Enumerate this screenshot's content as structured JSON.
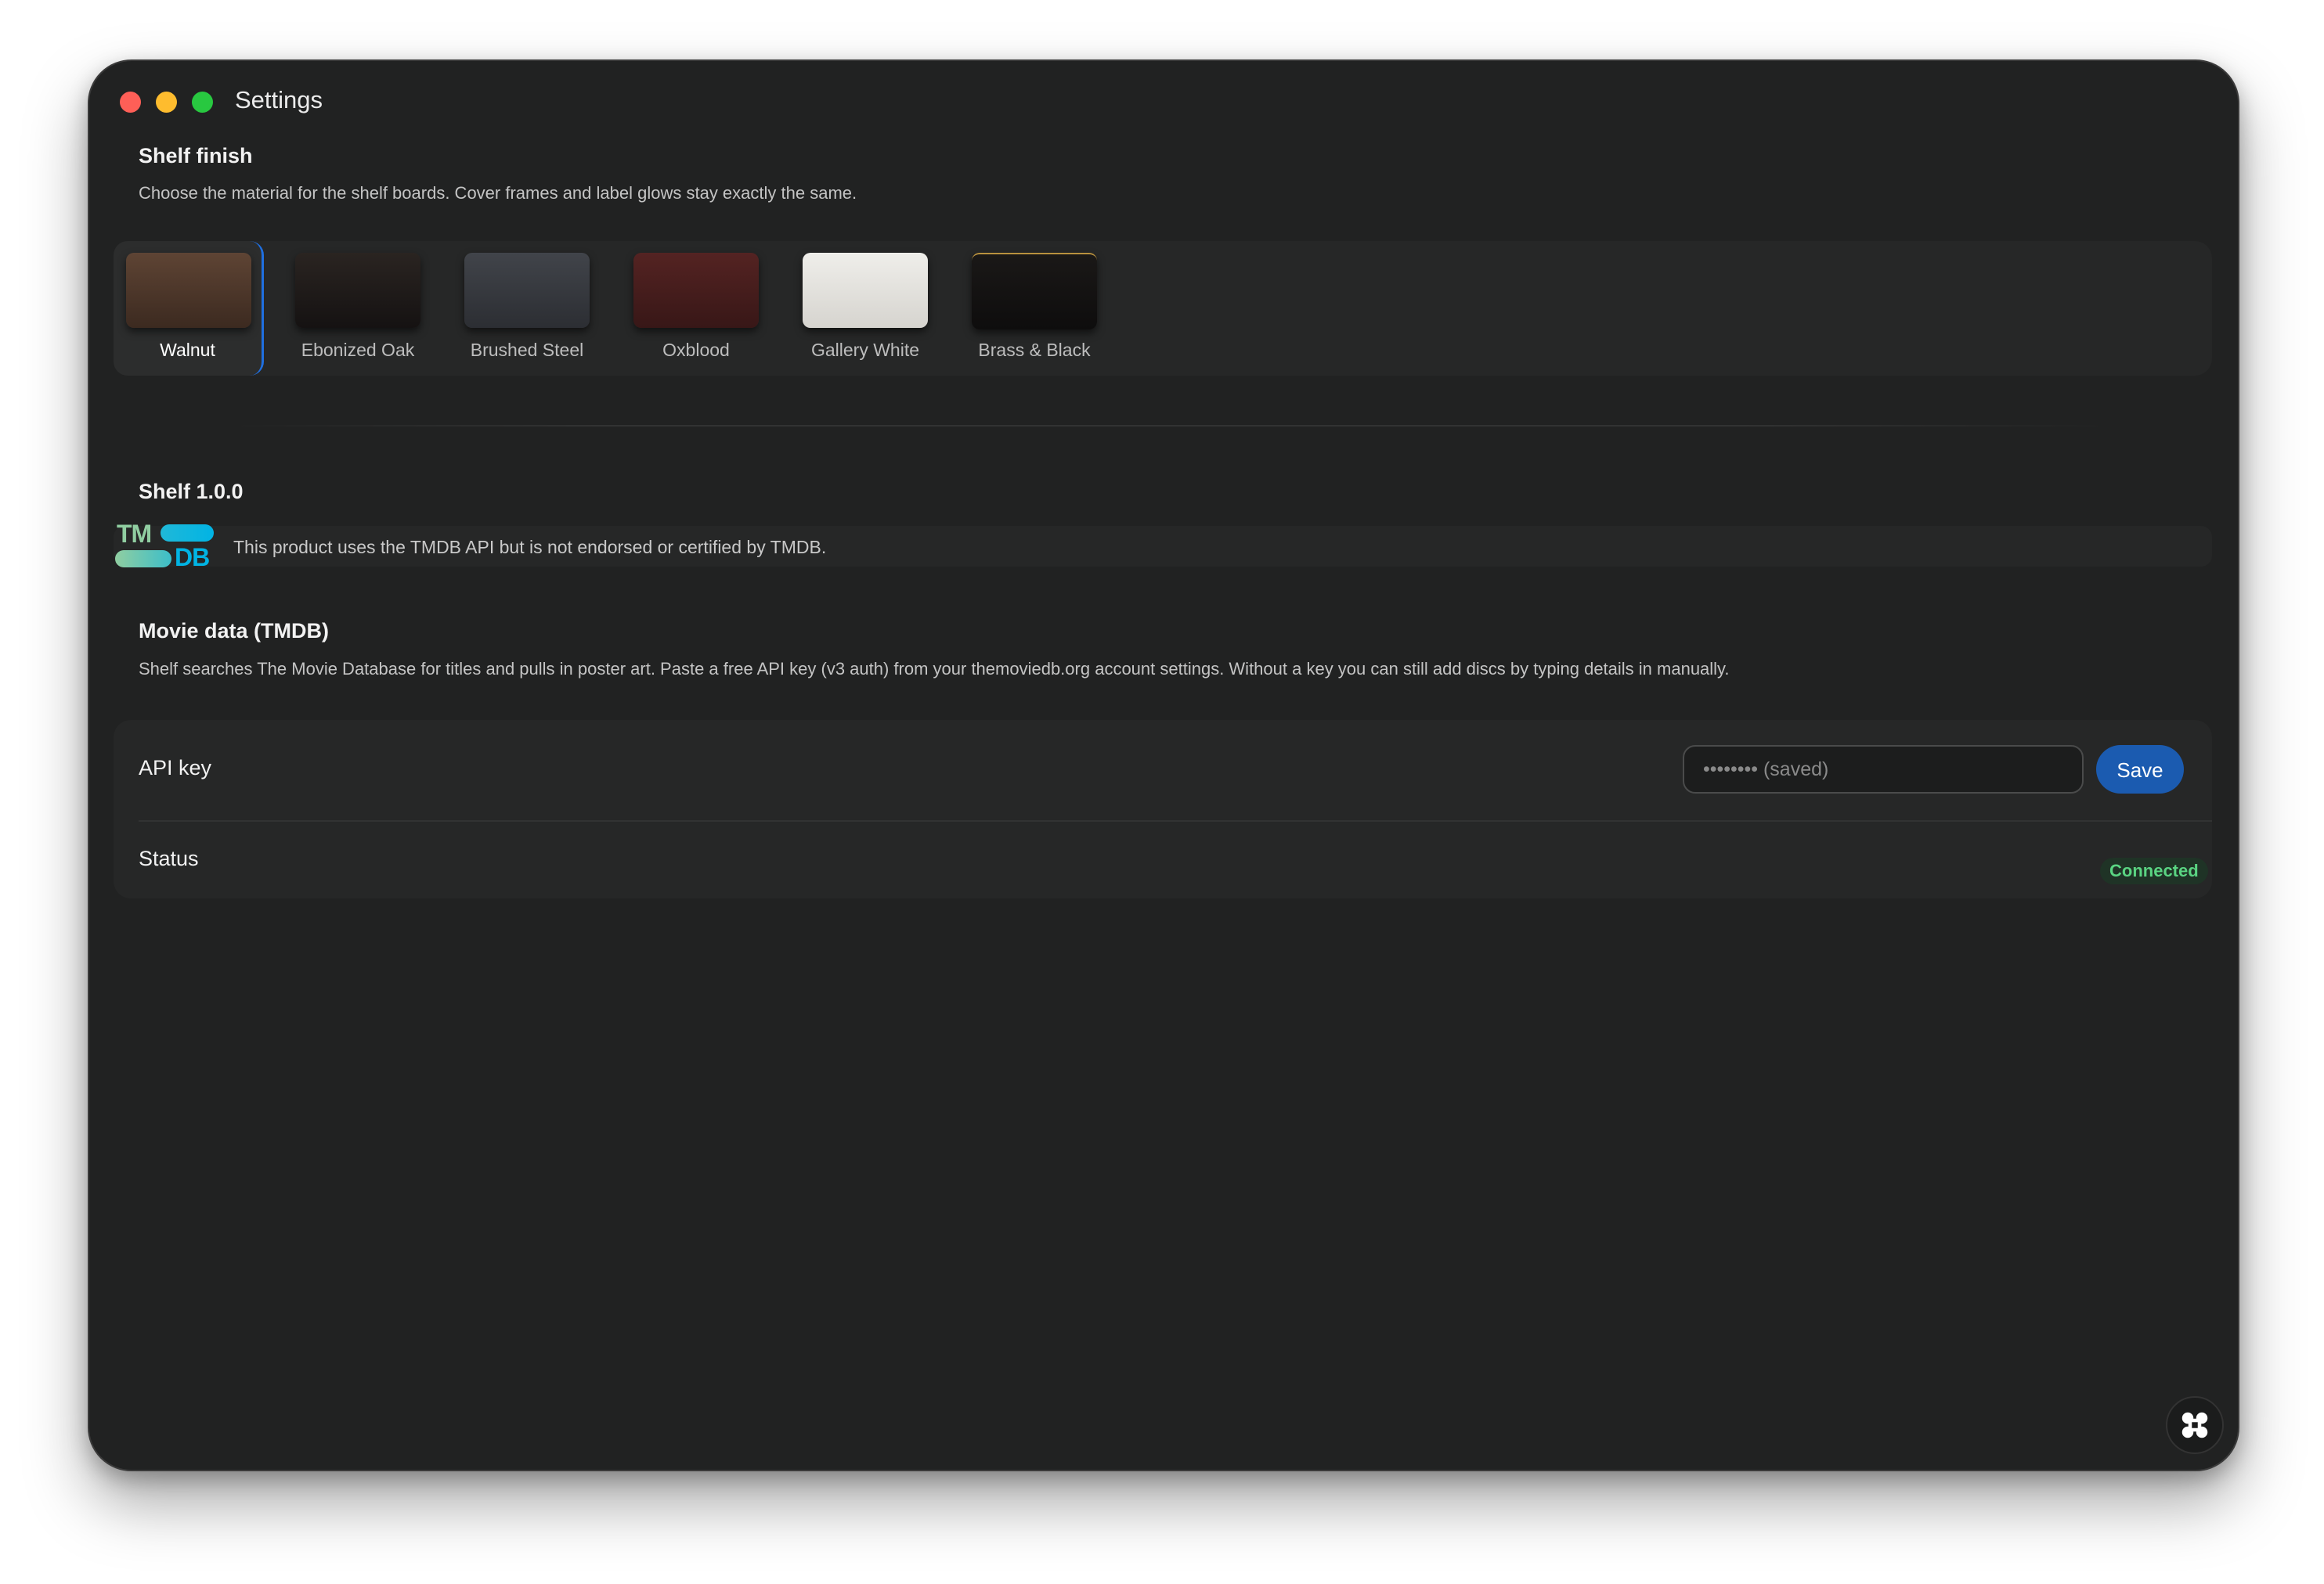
{
  "window": {
    "title": "Settings"
  },
  "shelf_finish": {
    "title": "Shelf finish",
    "description": "Choose the material for the shelf boards. Cover frames and label glows stay exactly the same.",
    "selected": "Walnut",
    "options": [
      {
        "label": "Walnut",
        "color": "#5a4030"
      },
      {
        "label": "Ebonized Oak",
        "color": "#221c1a"
      },
      {
        "label": "Brushed Steel",
        "color": "#3a3d43"
      },
      {
        "label": "Oxblood",
        "color": "#4a1f1f"
      },
      {
        "label": "Gallery White",
        "color": "#e4e3df"
      },
      {
        "label": "Brass & Black",
        "color": "#151414"
      }
    ]
  },
  "about": {
    "title": "Shelf 1.0.0",
    "logo_top": "TM",
    "logo_bottom": "DB",
    "attribution": "This product uses the TMDB API but is not endorsed or certified by TMDB."
  },
  "movie_data": {
    "title": "Movie data (TMDB)",
    "description": "Shelf searches The Movie Database for titles and pulls in poster art. Paste a free API key (v3 auth) from your themoviedb.org account settings. Without a key you can still add discs by typing details in manually.",
    "api_key_label": "API key",
    "api_key_placeholder": "•••••••• (saved)",
    "save_label": "Save",
    "status_label": "Status",
    "status_value": "Connected"
  }
}
